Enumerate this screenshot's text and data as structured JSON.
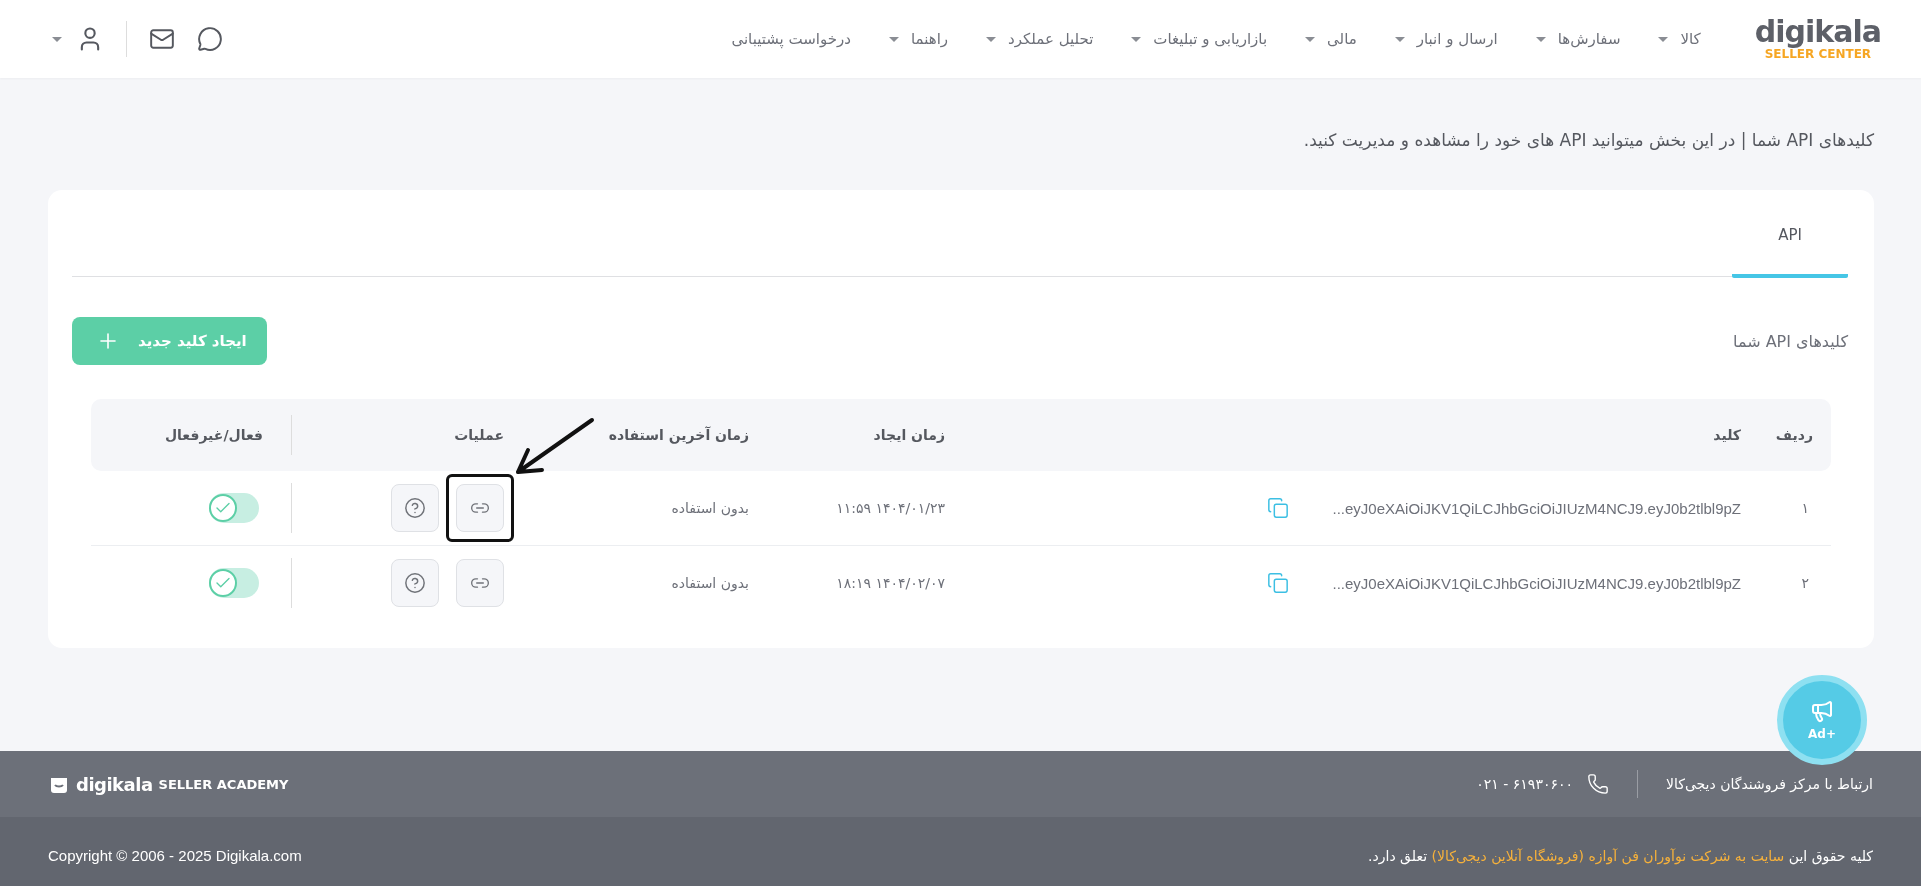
{
  "header": {
    "logo": {
      "name": "digikala",
      "subtitle": "SELLER CENTER"
    },
    "nav": [
      {
        "label": "کالا",
        "dropdown": true
      },
      {
        "label": "سفارش‌ها",
        "dropdown": true
      },
      {
        "label": "ارسال و انبار",
        "dropdown": true
      },
      {
        "label": "مالی",
        "dropdown": true
      },
      {
        "label": "بازاریابی و تبلیغات",
        "dropdown": true
      },
      {
        "label": "تحلیل عملکرد",
        "dropdown": true
      },
      {
        "label": "راهنما",
        "dropdown": true
      },
      {
        "label": "درخواست پشتیبانی",
        "dropdown": false
      }
    ]
  },
  "page_title": "کلیدهای API شما | در این بخش میتوانید API های خود را مشاهده و مدیریت کنید.",
  "tabs": [
    {
      "label": "API",
      "selected": true
    }
  ],
  "section_title": "کلیدهای API شما",
  "create_button": "ایجاد کلید جدید",
  "table": {
    "columns": [
      "ردیف",
      "کلید",
      "زمان ایجاد",
      "زمان آخرین استفاده",
      "عملیات",
      "فعال/غیرفعال"
    ],
    "rows": [
      {
        "index": "۱",
        "key": "eyJ0eXAiOiJKV1QiLCJhbGciOiJIUzM4NCJ9.eyJ0b2tlbl9pZ...",
        "created": "۱۴۰۴/۰۱/۲۳ ۱۱:۵۹",
        "last_used": "بدون استفاده",
        "active": true,
        "highlight": true
      },
      {
        "index": "۲",
        "key": "eyJ0eXAiOiJKV1QiLCJhbGciOiJIUzM4NCJ9.eyJ0b2tlbl9pZ...",
        "created": "۱۴۰۴/۰۲/۰۷ ۱۸:۱۹",
        "last_used": "بدون استفاده",
        "active": true,
        "highlight": false
      }
    ]
  },
  "ad_button": "+Ad",
  "footer": {
    "contact_label": "ارتباط با مرکز فروشندگان دیجی‌کالا",
    "phone": "۰۲۱ - ۶۱۹۳۰۶۰۰",
    "academy_logo": {
      "name": "digikala",
      "subtitle": "SELLER ACADEMY"
    },
    "rights": {
      "prefix": "کلیه حقوق این",
      "link": "سایت به شرکت نوآوران فن آوازه (فروشگاه آنلاین دیجی‌کالا)",
      "suffix": "تعلق دارد."
    },
    "copyright": "Copyright © 2006 - 2025 Digikala.com"
  }
}
